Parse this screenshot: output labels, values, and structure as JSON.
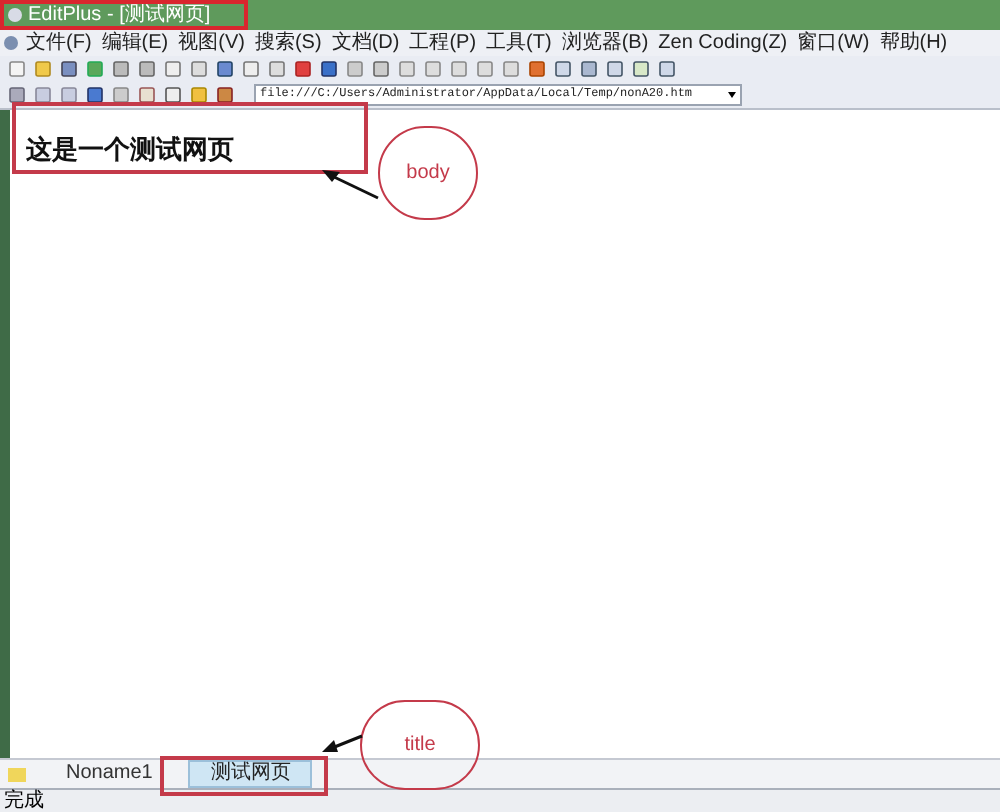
{
  "window": {
    "title": "EditPlus - [测试网页]"
  },
  "menu": [
    "文件(F)",
    "编辑(E)",
    "视图(V)",
    "搜索(S)",
    "文档(D)",
    "工程(P)",
    "工具(T)",
    "浏览器(B)",
    "Zen Coding(Z)",
    "窗口(W)",
    "帮助(H)"
  ],
  "address_bar": {
    "value": "file:///C:/Users/Administrator/AppData/Local/Temp/nonA20.htm"
  },
  "page": {
    "heading": "这是一个测试网页"
  },
  "tabs": [
    {
      "label": "Noname1",
      "selected": false
    },
    {
      "label": "测试网页",
      "selected": true
    }
  ],
  "status_bar": "完成",
  "annotations": [
    {
      "label": "body"
    },
    {
      "label": "title"
    }
  ]
}
